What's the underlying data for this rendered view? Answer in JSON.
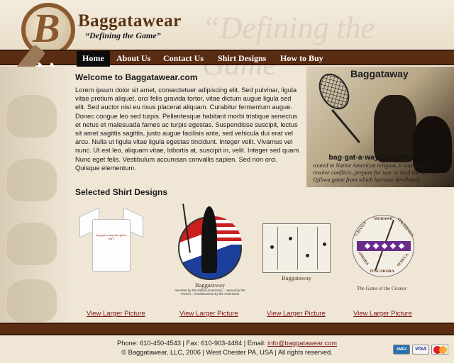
{
  "header": {
    "logo_letter": "B",
    "brand": "Baggatawear",
    "slogan": "“Defining the Game”",
    "slogan_big": "“Defining the Game”"
  },
  "nav": {
    "items": [
      {
        "label": "Home",
        "active": true
      },
      {
        "label": "About Us",
        "active": false
      },
      {
        "label": "Contact Us",
        "active": false
      },
      {
        "label": "Shirt Designs",
        "active": false
      },
      {
        "label": "How to Buy",
        "active": false
      }
    ]
  },
  "main": {
    "welcome_title": "Welcome to Baggatawear.com",
    "body": "Lorem ipsum dolor sit amet, consectetuer adipiscing elit. Sed pulvinar, ligula vitae pretium aliquet, orci felis gravida tortor, vitae dictum augue ligula sed elit. Sed auctor nisi eu risus placerat aliquam. Curabitur fermentum augue. Donec congue leo sed turpis. Pellentesque habitant morbi tristique senectus et netus et malesuada fames ac turpis egestas. Suspendisse suscipit, lectus sit amet sagittis sagittis, justo augue facilisis ante, sed vehicula dui erat vel arcu. Nulla ut ligula vitae ligula egestas tincidunt. Integer velit. Vivamus vel nunc. Ut est leo, aliquam vitae, lobortis at, suscipit in, velit. Integer sed quam. Nunc eget felis. Vestibulum accumsan convallis sapien. Sed non orci. Quisque elementum.",
    "selected_title": "Selected Shirt Designs"
  },
  "feature": {
    "title": "Baggataway",
    "pronunciation": "bag·gat·a·way:(bu-gat’u-wa”)",
    "description": "rooted in Native American religion, it was played to resolve conflicts, prepare for war or heal the sick, an Ojibwa game from which lacrosse developed."
  },
  "products": [
    {
      "print_text": "bag·gat·a·way:(bu-gat’u-wa”)",
      "link": "View Larger Picture"
    },
    {
      "caption": "Baggataway",
      "small_text": "Invented by the Native Americans... named by the French... revolutionized by the Americans",
      "link": "View Larger Picture"
    },
    {
      "caption": "Baggataway",
      "link": "View Larger Picture"
    },
    {
      "words": [
        "MOHAWK",
        "ONONDAGA",
        "CAYUGA",
        "SENECA",
        "ONEIDA",
        "TUSCARORA"
      ],
      "caption": "The Game of the Creator",
      "link": "View Larger Picture"
    }
  ],
  "footer": {
    "phone": "Phone: 610-450-4543 | Fax: 610-903-4484 | Email: ",
    "email": "info@baggatawear.com",
    "copyright": "© Baggatawear, LLC, 2006 | West Chester PA, USA | All rights reserved.",
    "cards": [
      "AMEX",
      "VISA",
      "MasterCard"
    ]
  },
  "colors": {
    "nav_bg": "#5a2d12",
    "nav_active": "#0c0c0c",
    "link": "#7a1818",
    "page_bg": "#efe6d6"
  }
}
